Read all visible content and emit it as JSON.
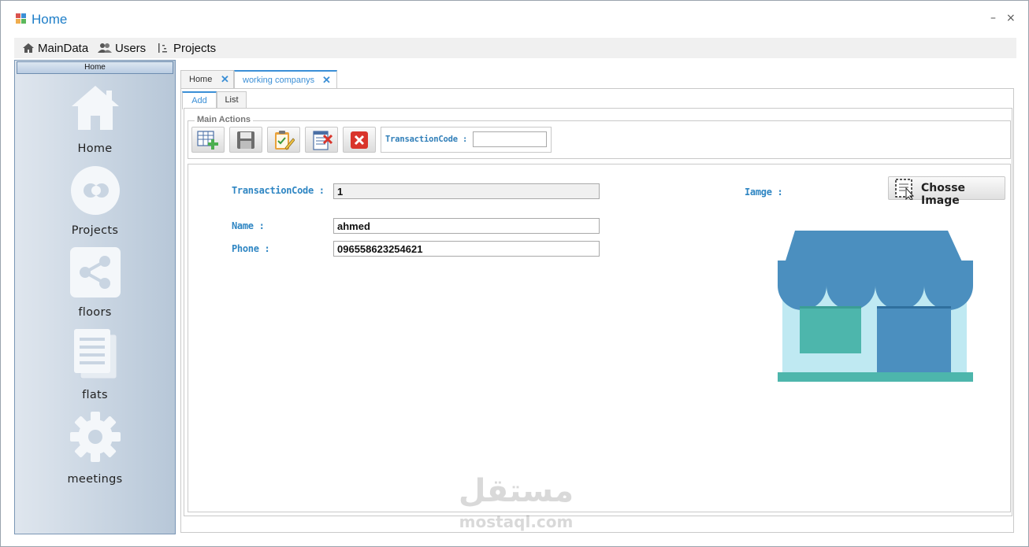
{
  "window": {
    "title": "Home",
    "minimize_glyph": "–",
    "close_glyph": "×"
  },
  "menu": {
    "items": [
      {
        "label": "MainData",
        "icon": "home-icon"
      },
      {
        "label": "Users",
        "icon": "users-icon"
      },
      {
        "label": "Projects",
        "icon": "projects-icon"
      }
    ]
  },
  "sidebar": {
    "header": "Home",
    "items": [
      {
        "label": "Home",
        "icon": "house-icon"
      },
      {
        "label": "Projects",
        "icon": "circles-icon"
      },
      {
        "label": "floors",
        "icon": "share-icon"
      },
      {
        "label": "flats",
        "icon": "document-icon"
      },
      {
        "label": "meetings",
        "icon": "gear-icon"
      }
    ]
  },
  "tabs": [
    {
      "label": "Home",
      "close": "✕",
      "active": false
    },
    {
      "label": "working companys",
      "close": "✕",
      "active": true
    }
  ],
  "subtabs": [
    {
      "label": "Add",
      "active": true
    },
    {
      "label": "List",
      "active": false
    }
  ],
  "actions": {
    "legend": "Main Actions",
    "buttons": [
      "add-grid-icon",
      "save-icon",
      "edit-clipboard-icon",
      "delete-document-icon",
      "cancel-icon"
    ],
    "transaction_label": "TransactionCode :",
    "transaction_value": ""
  },
  "form": {
    "transaction_label": "TransactionCode :",
    "transaction_value": "1",
    "name_label": "Name :",
    "name_value": "ahmed",
    "phone_label": "Phone :",
    "phone_value": "096558623254621",
    "image_label": "Iamge :",
    "choose_button": "Chosse Image",
    "image_icon": "shop-storefront-image"
  },
  "watermark": {
    "arabic": "مستقل",
    "latin": "mostaql.com"
  },
  "colors": {
    "accent": "#3b8fd6",
    "label_blue": "#2f86c3",
    "sidebar_top": "#dfe6ee",
    "sidebar_bottom": "#b7c7d8",
    "shop_roof": "#4b8fbf",
    "shop_wall": "#bfe9f2",
    "shop_window": "#4db6ac",
    "shop_base": "#4db6ac"
  }
}
